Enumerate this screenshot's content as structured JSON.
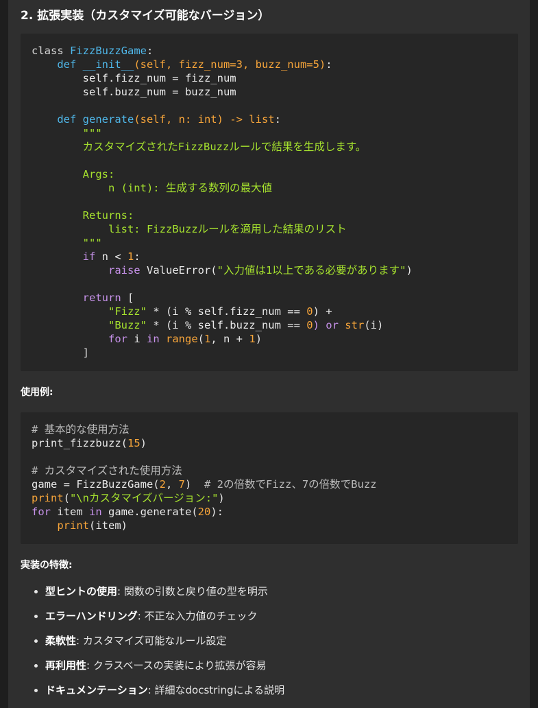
{
  "section_title": "2. 拡張実装（カスタマイズ可能なバージョン）",
  "code1": {
    "l1_kw": "class ",
    "l1_name": "FizzBuzzGame",
    "l1_end": ":",
    "l2_def": "def ",
    "l2_name": "__init__",
    "l2_args": "(self, fizz_num=3, buzz_num=5)",
    "l2_end": ":",
    "l3": "self.fizz_num = fizz_num",
    "l4": "self.buzz_num = buzz_num",
    "l6_def": "def ",
    "l6_name": "generate",
    "l6_args": "(self, n: int) -> ",
    "l6_ret": "list",
    "l6_end": ":",
    "doc_open": "\"\"\"",
    "doc1": "カスタマイズされたFizzBuzzルールで結果を生成します。",
    "doc_args": "Args:",
    "doc_args_item": "n (int): 生成する数列の最大値",
    "doc_returns": "Returns:",
    "doc_returns_item": "list: FizzBuzzルールを適用した結果のリスト",
    "doc_close": "\"\"\"",
    "if_kw": "if",
    "if_mid": " n < ",
    "if_num": "1",
    "if_end": ":",
    "raise_kw": "raise",
    "raise_mid": " ValueError(",
    "raise_str": "\"入力値は1以上である必要があります\"",
    "raise_end": ")",
    "return_kw": "return",
    "return_end": " [",
    "fizz_str": "\"Fizz\"",
    "fizz_mid": " * (i % self.fizz_num == ",
    "fizz_num": "0",
    "fizz_end": ") +",
    "buzz_str": "\"Buzz\"",
    "buzz_mid": " * (i % self.buzz_num == ",
    "buzz_num": "0",
    "buzz_or": ") or ",
    "buzz_fn": "str",
    "buzz_end": "(i)",
    "for_kw": "for",
    "for_mid": " i ",
    "for_in": "in",
    "for_fn": " range",
    "for_open": "(",
    "for_n1": "1",
    "for_mid2": ", n + ",
    "for_n2": "1",
    "for_end": ")",
    "close": "]"
  },
  "usage_label": "使用例:",
  "code2": {
    "c1": "# 基本的な使用方法",
    "l2_fn": "print_fizzbuzz(",
    "l2_num": "15",
    "l2_end": ")",
    "c2": "# カスタマイズされた使用方法",
    "l5_a": "game = FizzBuzzGame(",
    "l5_n1": "2",
    "l5_b": ", ",
    "l5_n2": "7",
    "l5_c": ")  ",
    "l5_cm": "# 2の倍数でFizz、7の倍数でBuzz",
    "l6_fn": "print",
    "l6_open": "(",
    "l6_str": "\"\\nカスタマイズバージョン:\"",
    "l6_end": ")",
    "l7_for": "for",
    "l7_mid": " item ",
    "l7_in": "in",
    "l7_b": " game.generate(",
    "l7_num": "20",
    "l7_end": "):",
    "l8_fn": "print",
    "l8_end": "(item)"
  },
  "features_label": "実装の特徴:",
  "features": [
    {
      "title": "型ヒントの使用",
      "desc": ": 関数の引数と戻り値の型を明示"
    },
    {
      "title": "エラーハンドリング",
      "desc": ": 不正な入力値のチェック"
    },
    {
      "title": "柔軟性",
      "desc": ": カスタマイズ可能なルール設定"
    },
    {
      "title": "再利用性",
      "desc": ": クラスベースの実装により拡張が容易"
    },
    {
      "title": "ドキュメンテーション",
      "desc": ": 詳細なdocstringによる説明"
    }
  ]
}
